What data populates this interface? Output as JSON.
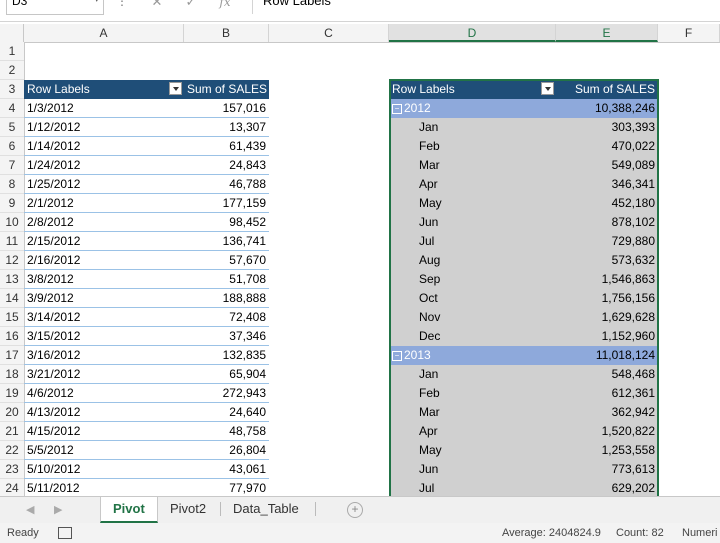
{
  "formula_bar": {
    "name_box": "D3",
    "content": "Row Labels"
  },
  "columns": [
    "A",
    "B",
    "C",
    "D",
    "E",
    "F"
  ],
  "rows": [
    "1",
    "2",
    "3",
    "4",
    "5",
    "6",
    "7",
    "8",
    "9",
    "10",
    "11",
    "12",
    "13",
    "14",
    "15",
    "16",
    "17",
    "18",
    "19",
    "20",
    "21",
    "22",
    "23",
    "24"
  ],
  "pivot1": {
    "header": [
      "Row Labels",
      "Sum of SALES"
    ],
    "rows": [
      [
        "1/3/2012",
        "157,016"
      ],
      [
        "1/12/2012",
        "13,307"
      ],
      [
        "1/14/2012",
        "61,439"
      ],
      [
        "1/24/2012",
        "24,843"
      ],
      [
        "1/25/2012",
        "46,788"
      ],
      [
        "2/1/2012",
        "177,159"
      ],
      [
        "2/8/2012",
        "98,452"
      ],
      [
        "2/15/2012",
        "136,741"
      ],
      [
        "2/16/2012",
        "57,670"
      ],
      [
        "3/8/2012",
        "51,708"
      ],
      [
        "3/9/2012",
        "188,888"
      ],
      [
        "3/14/2012",
        "72,408"
      ],
      [
        "3/15/2012",
        "37,346"
      ],
      [
        "3/16/2012",
        "132,835"
      ],
      [
        "3/21/2012",
        "65,904"
      ],
      [
        "4/6/2012",
        "272,943"
      ],
      [
        "4/13/2012",
        "24,640"
      ],
      [
        "4/15/2012",
        "48,758"
      ],
      [
        "5/5/2012",
        "26,804"
      ],
      [
        "5/10/2012",
        "43,061"
      ],
      [
        "5/11/2012",
        "77,970"
      ]
    ]
  },
  "pivot2": {
    "header": [
      "Row Labels",
      "Sum of SALES"
    ],
    "rows": [
      {
        "label": "2012",
        "value": "10,388,246",
        "year": true
      },
      {
        "label": "Jan",
        "value": "303,393"
      },
      {
        "label": "Feb",
        "value": "470,022"
      },
      {
        "label": "Mar",
        "value": "549,089"
      },
      {
        "label": "Apr",
        "value": "346,341"
      },
      {
        "label": "May",
        "value": "452,180"
      },
      {
        "label": "Jun",
        "value": "878,102"
      },
      {
        "label": "Jul",
        "value": "729,880"
      },
      {
        "label": "Aug",
        "value": "573,632"
      },
      {
        "label": "Sep",
        "value": "1,546,863"
      },
      {
        "label": "Oct",
        "value": "1,756,156"
      },
      {
        "label": "Nov",
        "value": "1,629,628"
      },
      {
        "label": "Dec",
        "value": "1,152,960"
      },
      {
        "label": "2013",
        "value": "11,018,124",
        "year": true
      },
      {
        "label": "Jan",
        "value": "548,468"
      },
      {
        "label": "Feb",
        "value": "612,361"
      },
      {
        "label": "Mar",
        "value": "362,942"
      },
      {
        "label": "Apr",
        "value": "1,520,822"
      },
      {
        "label": "May",
        "value": "1,253,558"
      },
      {
        "label": "Jun",
        "value": "773,613"
      },
      {
        "label": "Jul",
        "value": "629,202"
      }
    ]
  },
  "sheets": [
    "Pivot",
    "Pivot2",
    "Data_Table"
  ],
  "active_sheet": "Pivot",
  "status": {
    "ready": "Ready",
    "average": "Average: 2404824.9",
    "count": "Count: 82",
    "numeric": "Numeri"
  }
}
